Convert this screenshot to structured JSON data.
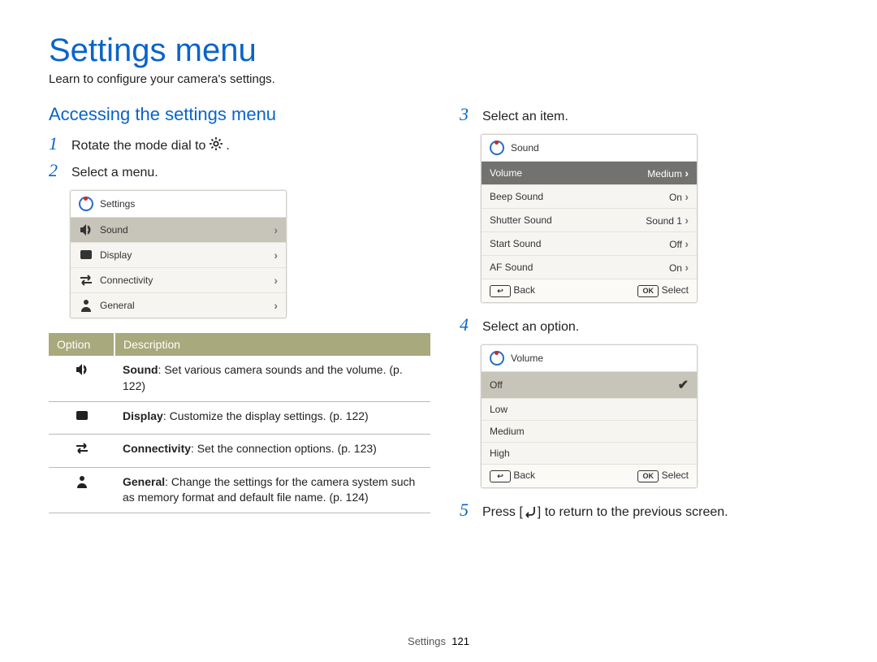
{
  "page": {
    "title": "Settings menu",
    "subtitle": "Learn to configure your camera's settings."
  },
  "section": {
    "heading": "Accessing the settings menu"
  },
  "steps": {
    "s1": {
      "num": "1",
      "text_a": "Rotate the mode dial to ",
      "text_b": "."
    },
    "s2": {
      "num": "2",
      "text": "Select a menu."
    },
    "s3": {
      "num": "3",
      "text": "Select an item."
    },
    "s4": {
      "num": "4",
      "text": "Select an option."
    },
    "s5": {
      "num": "5",
      "text_a": "Press [",
      "text_b": "] to return to the previous screen."
    }
  },
  "screen1": {
    "title": "Settings",
    "rows": [
      {
        "label": "Sound",
        "icon": "sound"
      },
      {
        "label": "Display",
        "icon": "display"
      },
      {
        "label": "Connectivity",
        "icon": "connectivity"
      },
      {
        "label": "General",
        "icon": "general"
      }
    ]
  },
  "screen2": {
    "title": "Sound",
    "rows": [
      {
        "label": "Volume",
        "value": "Medium"
      },
      {
        "label": "Beep Sound",
        "value": "On"
      },
      {
        "label": "Shutter Sound",
        "value": "Sound 1"
      },
      {
        "label": "Start Sound",
        "value": "Off"
      },
      {
        "label": "AF Sound",
        "value": "On"
      }
    ],
    "foot": {
      "back": "Back",
      "select": "Select"
    }
  },
  "screen3": {
    "title": "Volume",
    "rows": [
      {
        "label": "Off"
      },
      {
        "label": "Low"
      },
      {
        "label": "Medium"
      },
      {
        "label": "High"
      }
    ],
    "foot": {
      "back": "Back",
      "select": "Select"
    }
  },
  "table": {
    "headers": {
      "c0": "Option",
      "c1": "Description"
    },
    "rows": [
      {
        "icon": "sound",
        "strong": "Sound",
        "rest": ": Set various camera sounds and the volume. (p. 122)"
      },
      {
        "icon": "display",
        "strong": "Display",
        "rest": ": Customize the display settings. (p. 122)"
      },
      {
        "icon": "connectivity",
        "strong": "Connectivity",
        "rest": ": Set the connection options. (p. 123)"
      },
      {
        "icon": "general",
        "strong": "General",
        "rest": ": Change the settings for the camera system such as memory format and default file name. (p. 124)"
      }
    ]
  },
  "footer": {
    "label": "Settings",
    "page": "121"
  },
  "glyphs": {
    "ok": "OK",
    "back_arrow": "↩"
  }
}
